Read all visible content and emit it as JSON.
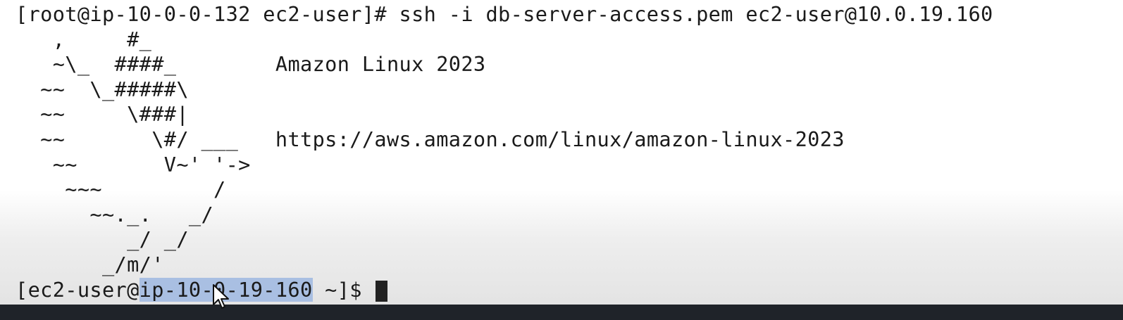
{
  "terminal": {
    "command_line": "[root@ip-10-0-0-132 ec2-user]# ssh -i db-server-access.pem ec2-user@10.0.19.160",
    "motd_art": [
      "   ,     #_",
      "   ~\\_  ####_        ",
      "  ~~  \\_#####\\",
      "  ~~     \\###|",
      "  ~~       \\#/ ___   ",
      "   ~~       V~' '->",
      "    ~~~         /",
      "      ~~._.   _/",
      "         _/ _/",
      "       _/m/'"
    ],
    "motd_title": "Amazon Linux 2023",
    "motd_url": "https://aws.amazon.com/linux/amazon-linux-2023",
    "prompt_before": "[ec2-user@",
    "prompt_selected": "ip-10-0-19-160",
    "prompt_after": " ~]$ "
  }
}
